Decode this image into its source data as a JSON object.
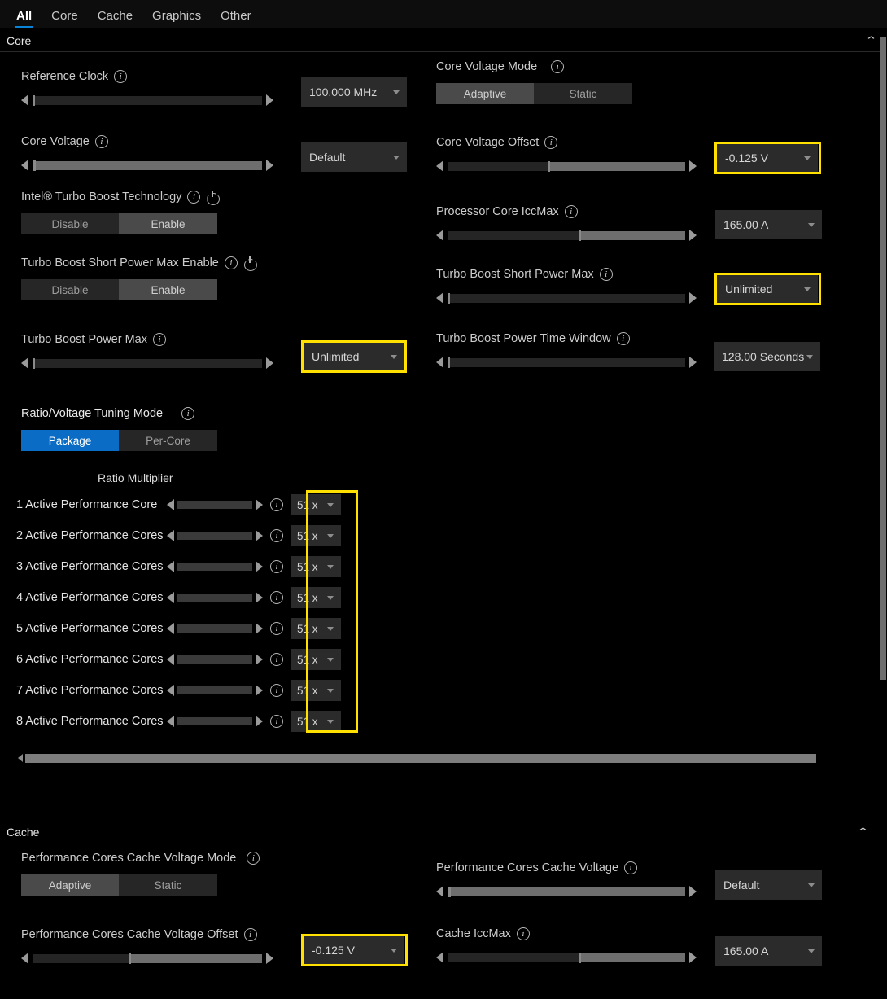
{
  "tabs": [
    {
      "label": "All",
      "active": true
    },
    {
      "label": "Core",
      "active": false
    },
    {
      "label": "Cache",
      "active": false
    },
    {
      "label": "Graphics",
      "active": false
    },
    {
      "label": "Other",
      "active": false
    }
  ],
  "sections": {
    "core": {
      "title": "Core",
      "collapse_icon": "chevron-up-icon",
      "chevron": "⌃"
    },
    "cache": {
      "title": "Cache",
      "collapse_icon": "chevron-up-icon",
      "chevron": "⌃"
    }
  },
  "icons": {
    "info": "info-icon",
    "power": "power-icon",
    "caret": "chevron-down-icon",
    "info_glyph": "i"
  },
  "colors": {
    "accent_blue": "#0a6cc4",
    "tab_underline": "#0a84d8",
    "highlight_yellow": "#ffe000",
    "panel_bg": "#000000",
    "combo_bg": "#2b2b2b",
    "slider_fill": "#6e6e6e"
  },
  "core_left": {
    "reference_clock": {
      "label": "Reference Clock",
      "value": "100.000 MHz",
      "slider_fill_pct": 0,
      "highlighted": false
    },
    "core_voltage": {
      "label": "Core Voltage",
      "value": "Default",
      "slider_fill_pct": 100,
      "highlighted": false
    },
    "turbo_boost_technology": {
      "label": "Intel® Turbo Boost Technology",
      "options": [
        "Disable",
        "Enable"
      ],
      "selected": "Enable"
    },
    "turbo_boost_short_power_max_enable": {
      "label": "Turbo Boost Short Power Max Enable",
      "options": [
        "Disable",
        "Enable"
      ],
      "selected": "Enable"
    },
    "turbo_boost_power_max": {
      "label": "Turbo Boost Power Max",
      "value": "Unlimited",
      "slider_fill_pct": 0,
      "highlighted": true
    },
    "ratio_voltage_tuning_mode": {
      "label": "Ratio/Voltage Tuning Mode",
      "options": [
        "Package",
        "Per-Core"
      ],
      "selected": "Package"
    }
  },
  "core_right": {
    "core_voltage_mode": {
      "label": "Core Voltage Mode",
      "options": [
        "Adaptive",
        "Static"
      ],
      "selected": "Adaptive"
    },
    "core_voltage_offset": {
      "label": "Core Voltage Offset",
      "value": "-0.125 V",
      "slider_fill_pct": 43,
      "highlighted": true
    },
    "processor_core_iccmax": {
      "label": "Processor Core IccMax",
      "value": "165.00 A",
      "slider_fill_pct": 56,
      "highlighted": false
    },
    "turbo_boost_short_power_max": {
      "label": "Turbo Boost Short Power Max",
      "value": "Unlimited",
      "slider_fill_pct": 0,
      "highlighted": true
    },
    "turbo_boost_power_time_window": {
      "label": "Turbo Boost Power Time Window",
      "value": "128.00 Seconds",
      "slider_fill_pct": 0,
      "highlighted": false
    }
  },
  "ratio_multiplier": {
    "header": "Ratio Multiplier",
    "highlighted": true,
    "rows": [
      {
        "label": "1 Active Performance Core",
        "value": "51 x",
        "slider_fill_pct": 0
      },
      {
        "label": "2 Active Performance Cores",
        "value": "51 x",
        "slider_fill_pct": 0
      },
      {
        "label": "3 Active Performance Cores",
        "value": "51 x",
        "slider_fill_pct": 0
      },
      {
        "label": "4 Active Performance Cores",
        "value": "51 x",
        "slider_fill_pct": 0
      },
      {
        "label": "5 Active Performance Cores",
        "value": "51 x",
        "slider_fill_pct": 0
      },
      {
        "label": "6 Active Performance Cores",
        "value": "51 x",
        "slider_fill_pct": 0
      },
      {
        "label": "7 Active Performance Cores",
        "value": "51 x",
        "slider_fill_pct": 0
      },
      {
        "label": "8 Active Performance Cores",
        "value": "51 x",
        "slider_fill_pct": 0
      }
    ]
  },
  "cache_left": {
    "pcore_cache_voltage_mode": {
      "label": "Performance Cores Cache Voltage Mode",
      "options": [
        "Adaptive",
        "Static"
      ],
      "selected": "Adaptive"
    },
    "pcore_cache_voltage_offset": {
      "label": "Performance Cores Cache Voltage Offset",
      "value": "-0.125 V",
      "slider_fill_pct": 43,
      "highlighted": true
    }
  },
  "cache_right": {
    "pcore_cache_voltage": {
      "label": "Performance Cores Cache Voltage",
      "value": "Default",
      "slider_fill_pct": 100,
      "highlighted": false
    },
    "cache_iccmax": {
      "label": "Cache IccMax",
      "value": "165.00 A",
      "slider_fill_pct": 56,
      "highlighted": false
    }
  }
}
